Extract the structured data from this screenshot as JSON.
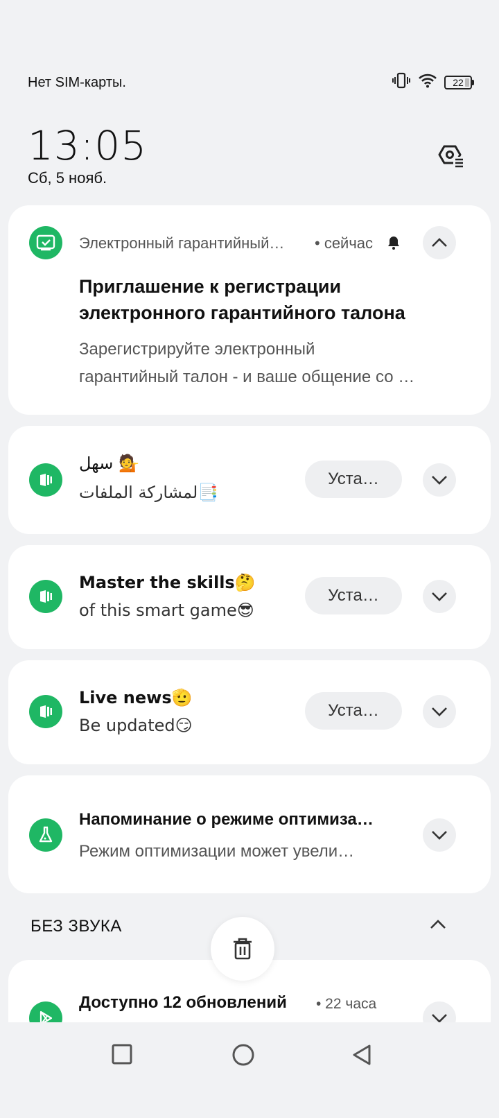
{
  "status_bar": {
    "carrier": "Нет SIM-карты.",
    "battery_level": "22",
    "icons": [
      "vibrate-icon",
      "wifi-icon",
      "battery-icon"
    ]
  },
  "clock": {
    "time": "13:05",
    "date": "Сб, 5 нояб."
  },
  "notifications": [
    {
      "app_name": "Электронный гарантийный…",
      "time": "• сейчас",
      "title_line1": "Приглашение к регистрации",
      "title_line2": "электронного гарантийного талона",
      "body_line1": "Зарегистрируйте электронный",
      "body_line2": "гарантийный талон - и ваше общение со …",
      "icon": "warranty-card-icon"
    },
    {
      "title": "سهل 💁",
      "body": "لمشاركة الملفات📑",
      "action": "Уста…",
      "icon": "store-icon"
    },
    {
      "title": "Master the skills🤔",
      "body": "of this smart game😎",
      "action": "Уста…",
      "icon": "store-icon"
    },
    {
      "title": "Live news🫡",
      "body": "Be updated😏",
      "action": "Уста…",
      "icon": "store-icon"
    },
    {
      "title": "Напоминание о режиме оптимиза…",
      "body": "Режим оптимизации может увели…",
      "icon": "flask-icon"
    }
  ],
  "silent_section": {
    "label": "БЕЗ ЗВУКА",
    "notification": {
      "title": "Доступно 12 обновлений",
      "time": "• 22 часа",
      "icon": "play-store-icon"
    }
  },
  "colors": {
    "accent_green": "#1fb764",
    "background": "#f1f2f4",
    "card": "#ffffff"
  }
}
